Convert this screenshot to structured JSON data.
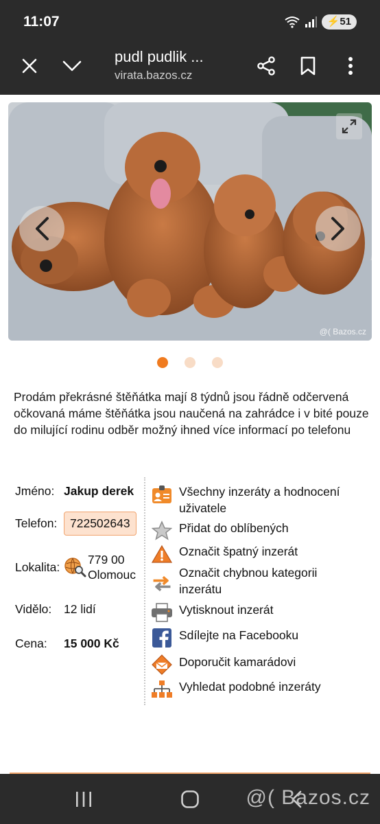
{
  "status_bar": {
    "time": "11:07",
    "battery": "51"
  },
  "browser": {
    "page_title": "pudl pudlik ...",
    "host": "virata.bazos.cz"
  },
  "gallery": {
    "watermark": "@( Bazos.cz",
    "slide_count": 3,
    "active_slide": 1
  },
  "listing": {
    "description": "Prodám překrásné štěňátka mají 8 týdnů jsou řádně odčervená očkovaná máme štěňátka jsou naučená na zahrádce i v bité pouze do milující rodinu odběr možný ihned více informací po telefonu",
    "name_label": "Jméno:",
    "name_value": "Jakup derek",
    "phone_label": "Telefon:",
    "phone_value": "722502643",
    "location_label": "Lokalita:",
    "location_zip": "779 00",
    "location_city": "Olomouc",
    "views_label": "Viděl​o:",
    "views_value": "12 lidí",
    "price_label": "Cena:",
    "price_value": "15 000 Kč"
  },
  "actions": [
    {
      "label": "Všechny inzeráty a hodnocení uživatele",
      "icon": "user-card-icon"
    },
    {
      "label": "Přidat do oblíbených",
      "icon": "star-icon"
    },
    {
      "label": "Označit špatný inzerát",
      "icon": "warning-icon"
    },
    {
      "label": "Označit chybnou kategorii inzerátu",
      "icon": "swap-arrows-icon"
    },
    {
      "label": "Vytisknout inzerát",
      "icon": "printer-icon"
    },
    {
      "label": "Sdílejte na Facebooku",
      "icon": "facebook-icon"
    },
    {
      "label": "Doporučit kamarádovi",
      "icon": "envelope-icon"
    },
    {
      "label": "Vyhledat podobné inzeráty",
      "icon": "sitemap-icon"
    }
  ],
  "footer": {
    "watermark": "@( Bazos.cz"
  },
  "colors": {
    "accent": "#f07b1f",
    "dark_bar": "#2b2b2b",
    "phone_bg": "#fde2cf"
  }
}
